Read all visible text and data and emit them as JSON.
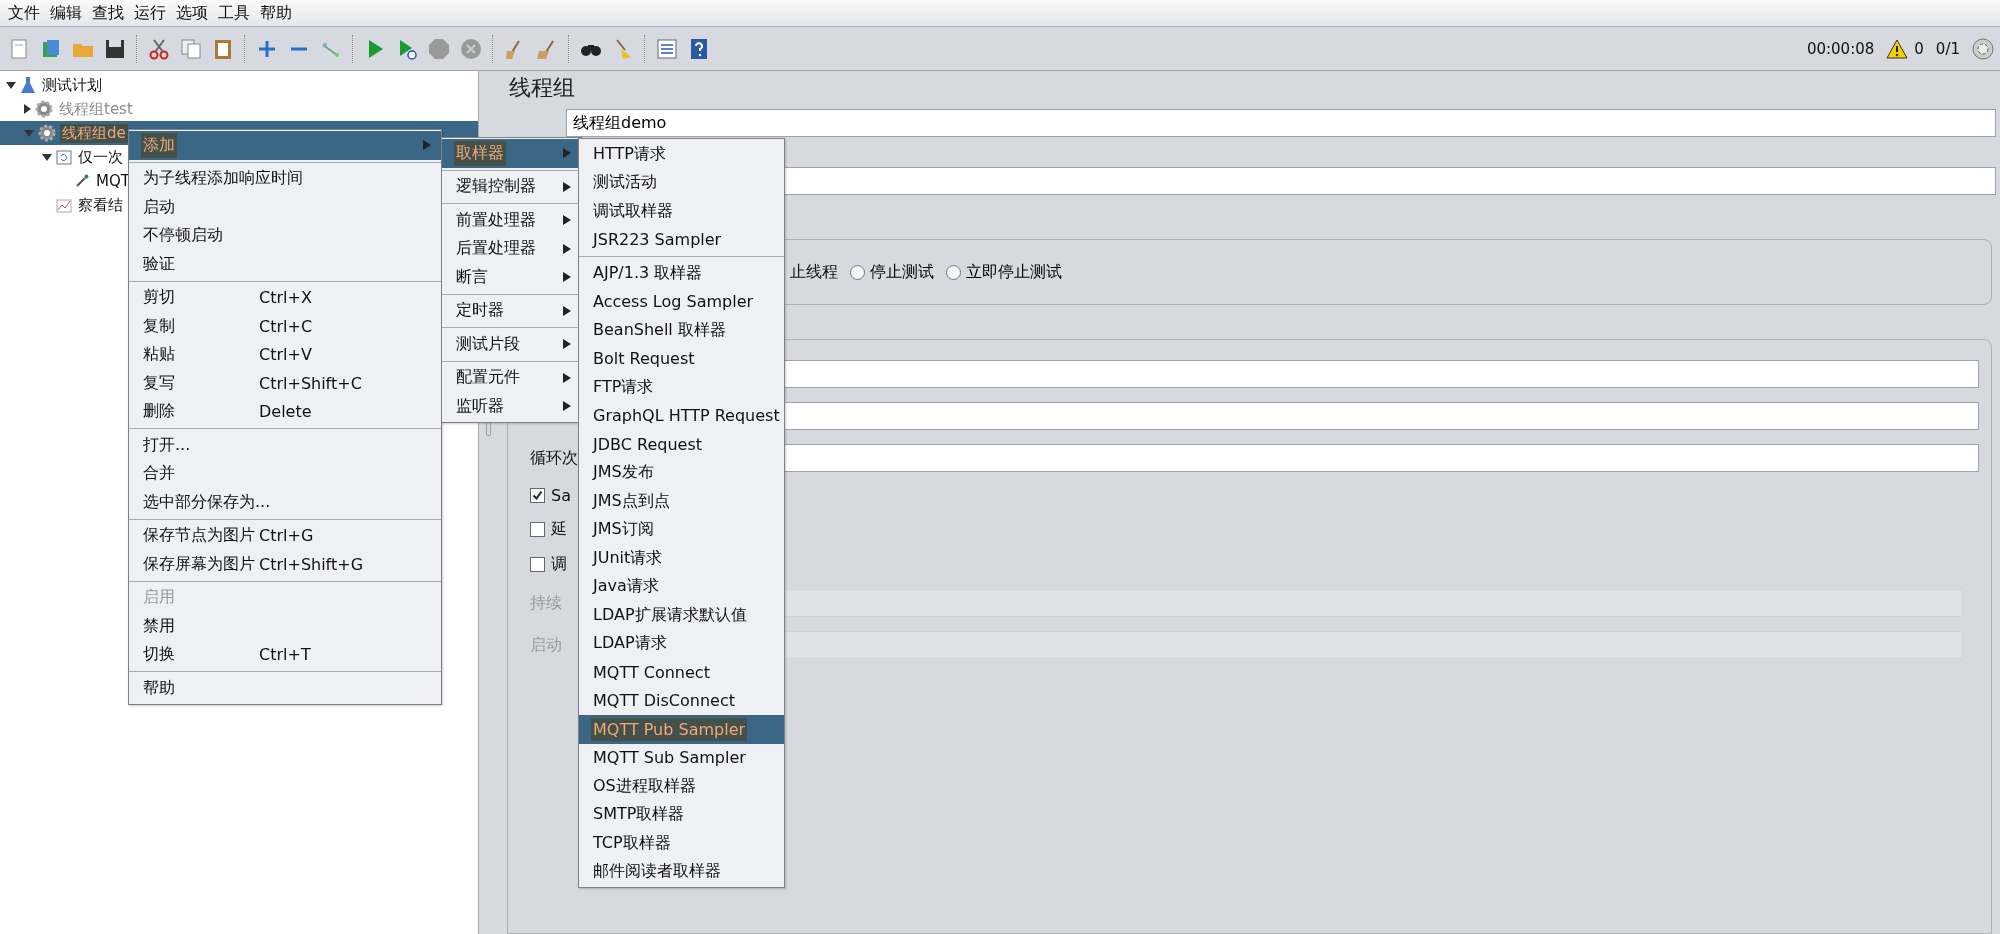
{
  "menu_bar": [
    "文件",
    "编辑",
    "查找",
    "运行",
    "选项",
    "工具",
    "帮助"
  ],
  "status": {
    "elapsed": "00:00:08",
    "warnings": "0",
    "threads": "0/1"
  },
  "tree": [
    {
      "label": "测试计划",
      "kind": "plan",
      "expanded": true,
      "selected": false,
      "disabled": false,
      "children": [
        {
          "label": "线程组test",
          "kind": "thread_group",
          "expanded": false,
          "selected": false,
          "disabled": true
        },
        {
          "label": "线程组de",
          "kind": "thread_group",
          "expanded": true,
          "selected": true,
          "disabled": false,
          "children": [
            {
              "label": "仅一次",
              "kind": "controller",
              "expanded": true,
              "selected": false,
              "disabled": false,
              "children": [
                {
                  "label": "MQT",
                  "kind": "sampler",
                  "selected": false,
                  "disabled": false
                }
              ]
            },
            {
              "label": "察看结",
              "kind": "listener",
              "selected": false,
              "disabled": false
            }
          ]
        }
      ]
    }
  ],
  "panel": {
    "title": "线程组",
    "name_value": "线程组demo",
    "error_action": {
      "partial_label": "止线程",
      "options": [
        {
          "label": "停止测试",
          "selected": false
        },
        {
          "label": "立即停止测试",
          "selected": false
        }
      ]
    },
    "fields": [
      {
        "kind": "unlabeled"
      },
      {
        "kind": "unlabeled"
      },
      {
        "kind": "labeled",
        "label": "循环次"
      }
    ],
    "checks": [
      {
        "label": "Sa",
        "checked": true
      },
      {
        "label": "延",
        "checked": false
      },
      {
        "label": "调",
        "checked": false
      }
    ],
    "disabled_fields": [
      {
        "label": "持续",
        "disabled": true
      },
      {
        "label": "启动",
        "disabled": true
      }
    ]
  },
  "context_menu": [
    [
      {
        "label": "添加",
        "submenu": true,
        "selected": true
      }
    ],
    [
      {
        "label": "为子线程添加响应时间"
      },
      {
        "label": "启动"
      },
      {
        "label": "不停顿启动"
      },
      {
        "label": "验证"
      }
    ],
    [
      {
        "label": "剪切",
        "shortcut": "Ctrl+X"
      },
      {
        "label": "复制",
        "shortcut": "Ctrl+C"
      },
      {
        "label": "粘贴",
        "shortcut": "Ctrl+V"
      },
      {
        "label": "复写",
        "shortcut": "Ctrl+Shift+C"
      },
      {
        "label": "删除",
        "shortcut": "Delete"
      }
    ],
    [
      {
        "label": "打开..."
      },
      {
        "label": "合并"
      },
      {
        "label": "选中部分保存为..."
      }
    ],
    [
      {
        "label": "保存节点为图片",
        "shortcut": "Ctrl+G"
      },
      {
        "label": "保存屏幕为图片",
        "shortcut": "Ctrl+Shift+G"
      }
    ],
    [
      {
        "label": "启用",
        "disabled": true
      },
      {
        "label": "禁用"
      },
      {
        "label": "切换",
        "shortcut": "Ctrl+T"
      }
    ],
    [
      {
        "label": "帮助"
      }
    ]
  ],
  "add_menu": [
    [
      {
        "label": "取样器",
        "submenu": true,
        "selected": true
      }
    ],
    [
      {
        "label": "逻辑控制器",
        "submenu": true
      }
    ],
    [
      {
        "label": "前置处理器",
        "submenu": true
      },
      {
        "label": "后置处理器",
        "submenu": true
      },
      {
        "label": "断言",
        "submenu": true
      }
    ],
    [
      {
        "label": "定时器",
        "submenu": true
      }
    ],
    [
      {
        "label": "测试片段",
        "submenu": true
      }
    ],
    [
      {
        "label": "配置元件",
        "submenu": true
      },
      {
        "label": "监听器",
        "submenu": true
      }
    ]
  ],
  "sampler_menu": [
    [
      {
        "label": "HTTP请求"
      },
      {
        "label": "测试活动"
      },
      {
        "label": "调试取样器"
      },
      {
        "label": "JSR223 Sampler"
      }
    ],
    [
      {
        "label": "AJP/1.3 取样器"
      },
      {
        "label": "Access Log Sampler"
      },
      {
        "label": "BeanShell 取样器"
      },
      {
        "label": "Bolt Request"
      },
      {
        "label": "FTP请求"
      },
      {
        "label": "GraphQL HTTP Request"
      },
      {
        "label": "JDBC Request"
      },
      {
        "label": "JMS发布"
      },
      {
        "label": "JMS点到点"
      },
      {
        "label": "JMS订阅"
      },
      {
        "label": "JUnit请求"
      },
      {
        "label": "Java请求"
      },
      {
        "label": "LDAP扩展请求默认值"
      },
      {
        "label": "LDAP请求"
      },
      {
        "label": "MQTT Connect"
      },
      {
        "label": "MQTT DisConnect"
      },
      {
        "label": "MQTT Pub Sampler",
        "selected": true
      },
      {
        "label": "MQTT Sub Sampler"
      },
      {
        "label": "OS进程取样器"
      },
      {
        "label": "SMTP取样器"
      },
      {
        "label": "TCP取样器"
      },
      {
        "label": "邮件阅读者取样器"
      }
    ]
  ]
}
